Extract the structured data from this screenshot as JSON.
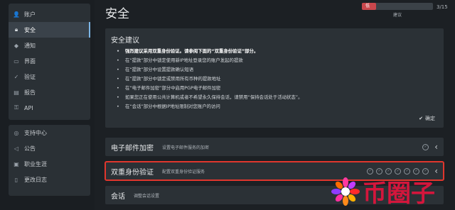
{
  "sidebar": {
    "group1": [
      {
        "label": "账户",
        "icon": "user-icon",
        "active": false
      },
      {
        "label": "安全",
        "icon": "lock-icon",
        "active": true
      },
      {
        "label": "通知",
        "icon": "bell-icon",
        "active": false
      },
      {
        "label": "界面",
        "icon": "monitor-icon",
        "active": false
      },
      {
        "label": "验证",
        "icon": "verify-icon",
        "active": false
      },
      {
        "label": "报告",
        "icon": "chart-icon",
        "active": false
      },
      {
        "label": "API",
        "icon": "key-icon",
        "active": false
      }
    ],
    "group2": [
      {
        "label": "支持中心",
        "icon": "support-icon"
      },
      {
        "label": "公告",
        "icon": "megaphone-icon"
      },
      {
        "label": "职业生涯",
        "icon": "briefcase-icon"
      },
      {
        "label": "更改日志",
        "icon": "document-icon"
      }
    ]
  },
  "main": {
    "title": "安全",
    "progress": {
      "fraction": 0.2,
      "text": "低",
      "label": "建议",
      "count": "3/15"
    },
    "advice": {
      "title": "安全建议",
      "items": [
        {
          "text": "强烈建议采用双重身份验证。请参阅下面的“双重身份验证”部分。",
          "strong": true
        },
        {
          "text": "在“提款”部分中锁定使用新IP地址登录您的账户发起的提款",
          "strong": false
        },
        {
          "text": "在“提款”部分中设置提款确认短语",
          "strong": false
        },
        {
          "text": "在“提款”部分中锁定或禁用所有币种的提款地址",
          "strong": false
        },
        {
          "text": "在“电子邮件加密”部分中启用PGP电子邮件加密",
          "strong": false
        },
        {
          "text": "如果您正在使用公共计算机或者不希望永久保持会话，请禁用“保持会话处于活动状态”。",
          "strong": false
        },
        {
          "text": "在“会话”部分中根据IP地址限制对您账户的访问",
          "strong": false
        }
      ],
      "confirm_label": "确定"
    },
    "sections": [
      {
        "title": "电子邮件加密",
        "desc": "设置电子邮件服务的加密",
        "checks": 1,
        "highlight": false
      },
      {
        "title": "双重身份验证",
        "desc": "配置双重身份验证服务",
        "checks": 7,
        "highlight": true
      },
      {
        "title": "会话",
        "desc": "调整会话设置",
        "checks": 0,
        "highlight": false
      }
    ]
  },
  "watermark": {
    "text": "币圈子"
  },
  "colors": {
    "accent": "#7cb5e6",
    "danger": "#c9474c",
    "highlight": "#e0362d"
  }
}
